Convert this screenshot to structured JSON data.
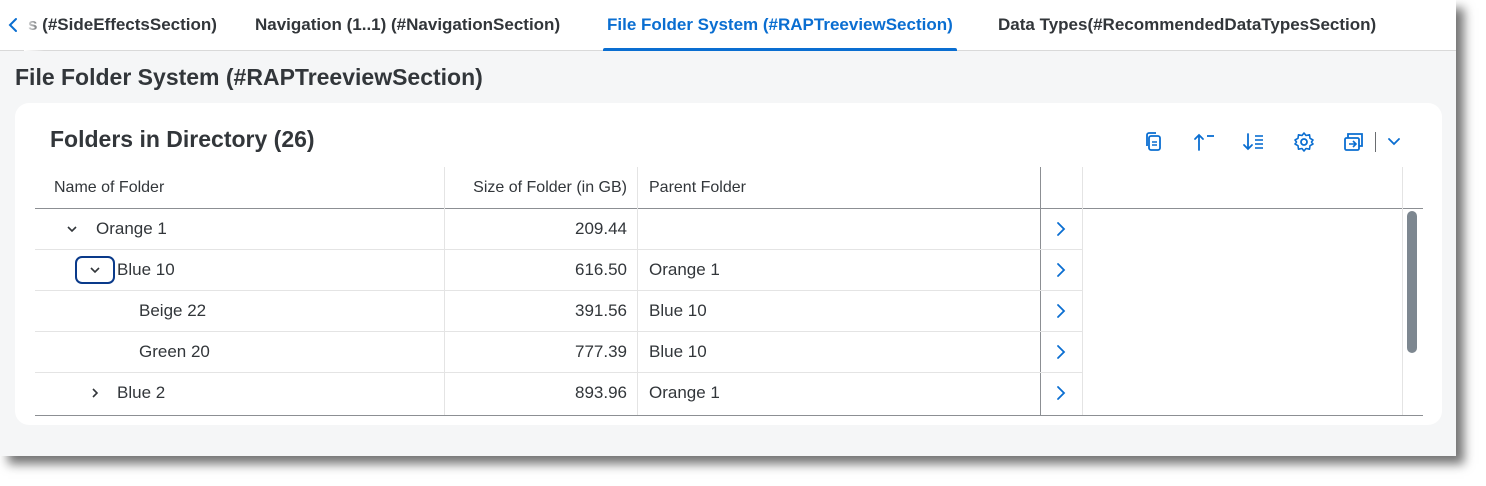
{
  "tabs": {
    "partial": "s (#SideEffectsSection)",
    "items": [
      {
        "label": "Navigation (1..1) (#NavigationSection)"
      },
      {
        "label": "File Folder System (#RAPTreeviewSection)"
      },
      {
        "label": "Data Types(#RecommendedDataTypesSection)"
      }
    ]
  },
  "section": {
    "title": "File Folder System (#RAPTreeviewSection)"
  },
  "card": {
    "title": "Folders in Directory (26)"
  },
  "toolbar": {
    "icons": [
      "copy-icon",
      "sort-ascending-icon",
      "sort-descending-icon",
      "settings-icon",
      "export-icon",
      "chevron-down-icon"
    ]
  },
  "table": {
    "columns": {
      "name": "Name of Folder",
      "size": "Size of Folder (in GB)",
      "parent": "Parent Folder"
    },
    "rows": [
      {
        "name": "Orange 1",
        "size": "209.44",
        "parent": "",
        "level": 0,
        "state": "expanded"
      },
      {
        "name": "Blue 10",
        "size": "616.50",
        "parent": "Orange 1",
        "level": 1,
        "state": "expanded-focused"
      },
      {
        "name": "Beige 22",
        "size": "391.56",
        "parent": "Blue 10",
        "level": 2,
        "state": "leaf"
      },
      {
        "name": "Green 20",
        "size": "777.39",
        "parent": "Blue 10",
        "level": 2,
        "state": "leaf"
      },
      {
        "name": "Blue 2",
        "size": "893.96",
        "parent": "Orange 1",
        "level": 1,
        "state": "collapsed"
      }
    ]
  },
  "colors": {
    "accent": "#0a6ed1",
    "text": "#32363a",
    "focus": "#0a3a8a"
  }
}
